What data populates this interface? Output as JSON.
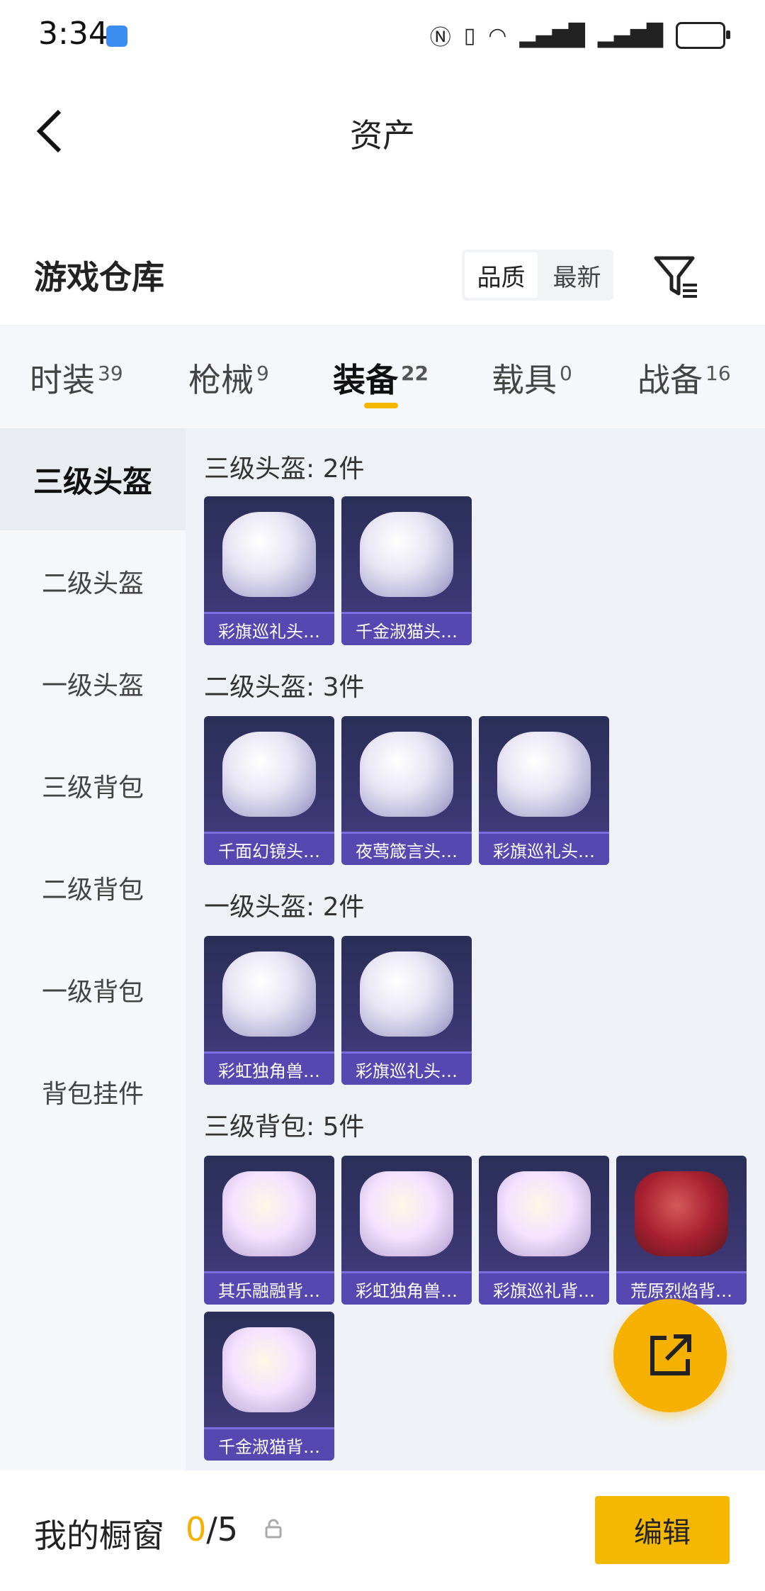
{
  "status": {
    "time": "3:34"
  },
  "header": {
    "title": "资产"
  },
  "warehouse": {
    "title": "游戏仓库",
    "toggle": [
      "品质",
      "最新"
    ]
  },
  "tabs": [
    {
      "label": "时装",
      "count": "39"
    },
    {
      "label": "枪械",
      "count": "9"
    },
    {
      "label": "装备",
      "count": "22"
    },
    {
      "label": "载具",
      "count": "0"
    },
    {
      "label": "战备",
      "count": "16"
    }
  ],
  "sidebar": [
    "三级头盔",
    "二级头盔",
    "一级头盔",
    "三级背包",
    "二级背包",
    "一级背包",
    "背包挂件"
  ],
  "sections": [
    {
      "title": "三级头盔: 2件",
      "items": [
        "彩旗巡礼头…",
        "千金淑猫头…"
      ]
    },
    {
      "title": "二级头盔: 3件",
      "items": [
        "千面幻镜头…",
        "夜莺箴言头…",
        "彩旗巡礼头…"
      ]
    },
    {
      "title": "一级头盔: 2件",
      "items": [
        "彩虹独角兽…",
        "彩旗巡礼头…"
      ]
    },
    {
      "title": "三级背包: 5件",
      "items": [
        "其乐融融背…",
        "彩虹独角兽…",
        "彩旗巡礼背…",
        "荒原烈焰背…",
        "千金淑猫背…"
      ]
    }
  ],
  "bottom": {
    "label": "我的橱窗",
    "current": "0",
    "total": "/5",
    "edit": "编辑"
  }
}
